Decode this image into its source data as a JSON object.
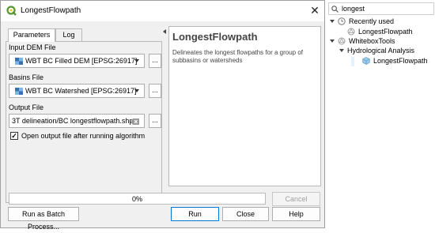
{
  "dialog": {
    "title": "LongestFlowpath",
    "close_glyph": "✕",
    "tabs": [
      "Parameters",
      "Log"
    ],
    "fields": {
      "input_dem_label": "Input DEM File",
      "input_dem_value": "WBT BC Filled DEM [EPSG:26917]",
      "basins_label": "Basins File",
      "basins_value": "WBT BC Watershed [EPSG:26917]",
      "output_label": "Output File",
      "output_value": "3T delineation/BC longestflowpath.shp",
      "dots_label": "...",
      "open_output_label": "Open output file after running algorithm",
      "open_output_checked": "✓"
    },
    "help": {
      "title": "LongestFlowpath",
      "description": "Delineates the longest flowpaths for a group of subbasins or watersheds"
    },
    "progress": {
      "value": 0,
      "text": "0%"
    },
    "buttons": {
      "cancel": "Cancel",
      "batch": "Run as Batch Process...",
      "run": "Run",
      "close": "Close",
      "help": "Help"
    }
  },
  "toolbox": {
    "search_value": "longest",
    "items": [
      {
        "label": "Recently used",
        "icon": "clock-icon"
      },
      {
        "label": "LongestFlowpath",
        "icon": "tool-icon"
      },
      {
        "label": "WhiteboxTools",
        "icon": "provider-icon"
      },
      {
        "label": "Hydrological Analysis",
        "icon": "none"
      },
      {
        "label": "LongestFlowpath",
        "icon": "tool-icon"
      }
    ]
  },
  "colors": {
    "accent_blue": "#0078d7",
    "qgis_green": "#589632",
    "progress_green": "#06b025"
  }
}
